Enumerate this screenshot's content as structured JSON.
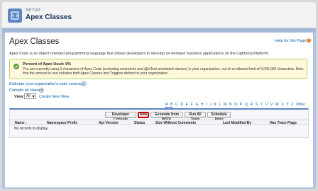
{
  "header": {
    "kicker": "SETUP",
    "title": "Apex Classes"
  },
  "page": {
    "title": "Apex Classes",
    "help_link": "Help for this Page",
    "description": "Apex Code is an object oriented programming language that allows developers to develop on-demand business applications on the Lightning Platform."
  },
  "alert": {
    "title": "Percent of Apex Used: 0%",
    "body": "You are currently using 0 characters of Apex Code (excluding comments and @isTest annotated classes) in your organization, out of an allowed limit of 6,000,000 characters. Note that the amount in use includes both Apex Classes and Triggers defined in your organization."
  },
  "links": {
    "estimate": "Estimate your organization's code coverage",
    "compile": "Compile all classes",
    "info_glyph": "i"
  },
  "view": {
    "label": "View:",
    "selected": "All",
    "create_new": "Create New View"
  },
  "alphabet": [
    "A",
    "B",
    "C",
    "D",
    "E",
    "F",
    "G",
    "H",
    "I",
    "J",
    "K",
    "L",
    "M",
    "N",
    "O",
    "P",
    "Q",
    "R",
    "S",
    "T",
    "U",
    "V",
    "W",
    "X",
    "Y",
    "Z",
    "Other"
  ],
  "alphabet_all": "All",
  "buttons": {
    "developer_console": "Developer Console",
    "new": "New",
    "generate_wsdl": "Generate from WSDL",
    "run_all_tests": "Run All Tests",
    "schedule_apex": "Schedule Apex"
  },
  "table": {
    "columns": [
      "Name ↑",
      "Namespace Prefix",
      "Api Version",
      "Status",
      "Size Without Comments",
      "Last Modified By",
      "Has Trace Flags"
    ],
    "empty_message": "No records to display."
  },
  "colors": {
    "brand_blue": "#5b86c5",
    "link": "#015ba7",
    "alert_border": "#b5d06b",
    "alert_bg": "#fff9db",
    "highlight_red": "#d60000"
  },
  "icons": {
    "setup": "gear-code-icon",
    "help": "help-icon",
    "alert": "checkmark-icon"
  }
}
